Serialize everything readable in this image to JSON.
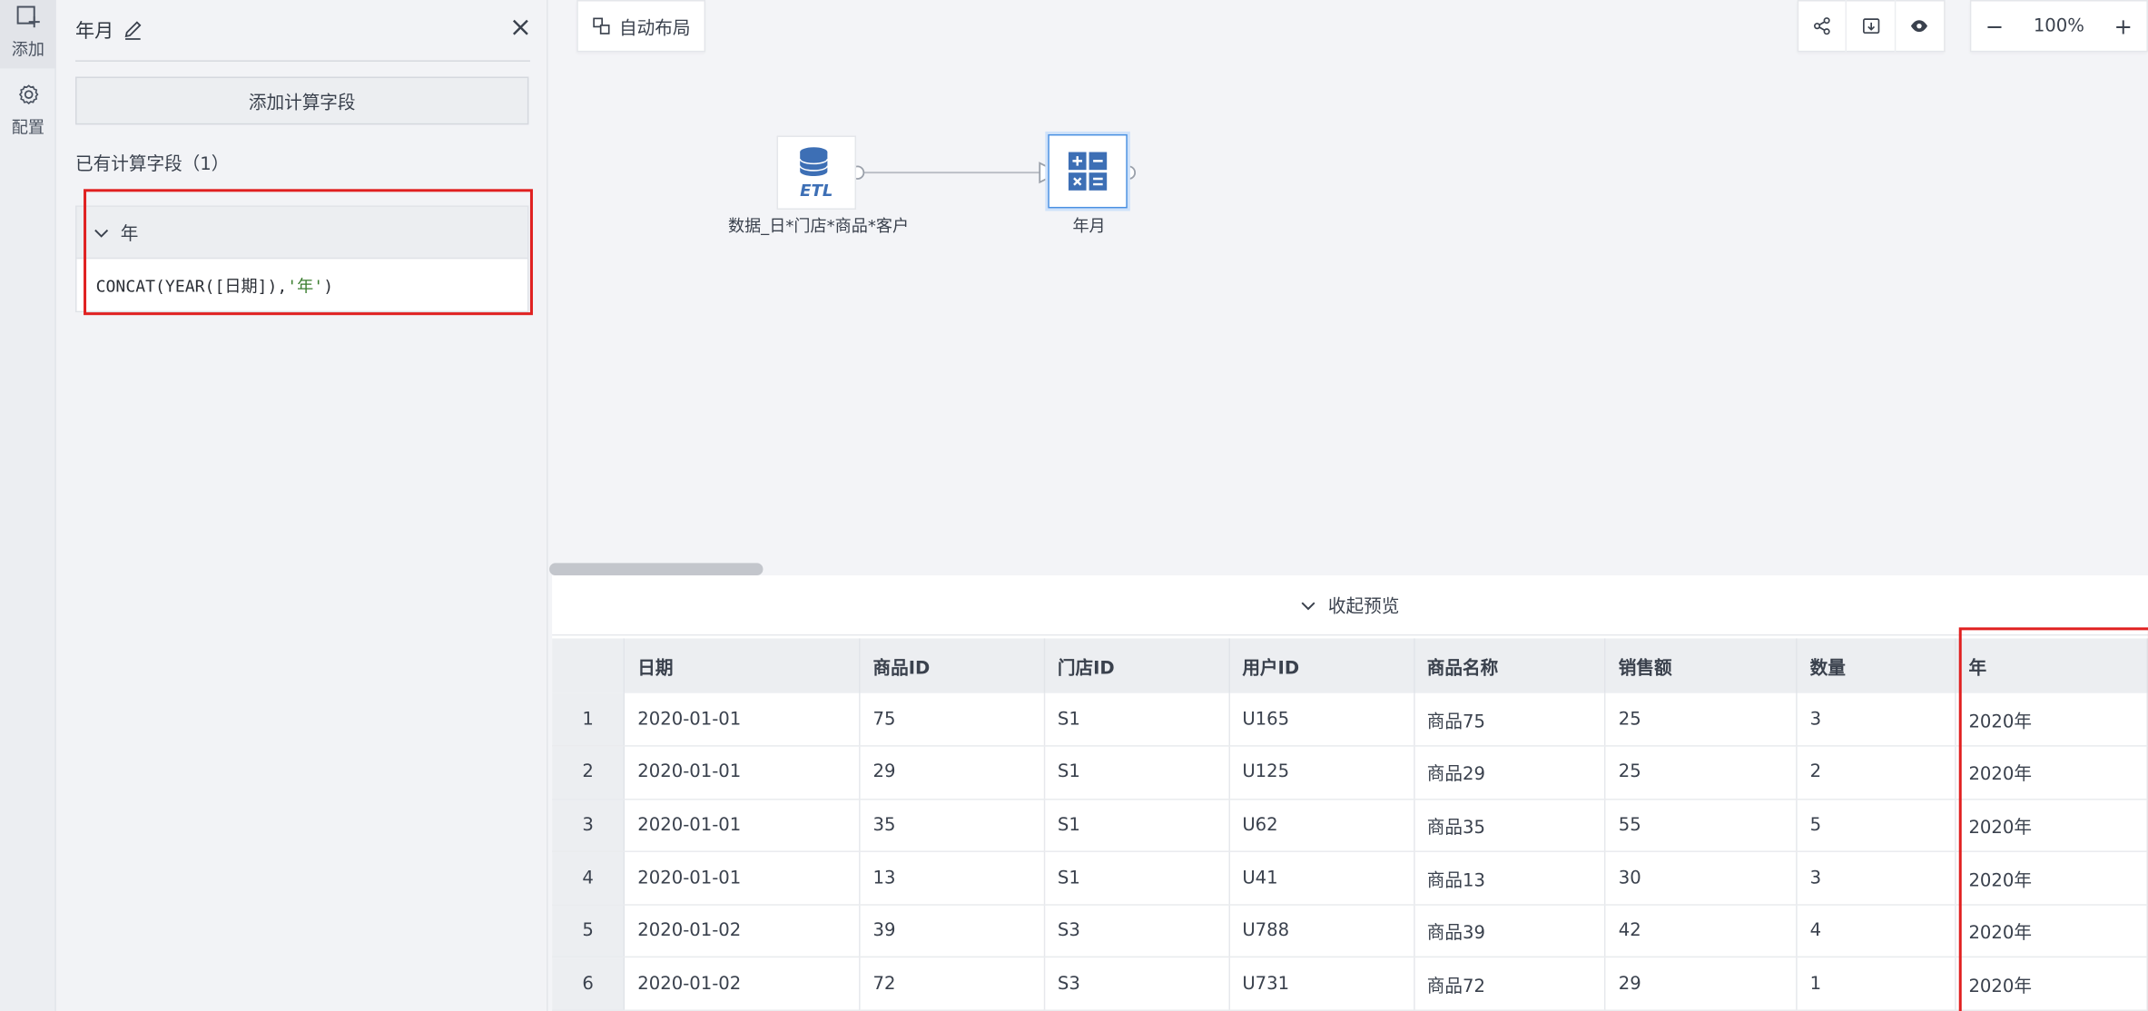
{
  "rail": {
    "add_label": "添加",
    "config_label": "配置"
  },
  "panel": {
    "title": "年月",
    "add_calc_label": "添加计算字段",
    "existing_label": "已有计算字段（1）",
    "field": {
      "name": "年",
      "formula_prefix": "CONCAT(YEAR([日期]),",
      "formula_string": "'年'",
      "formula_suffix": ")"
    }
  },
  "toolbar": {
    "auto_layout_label": "自动布局",
    "zoom_value": "100%",
    "zoom_out": "−",
    "zoom_in": "+",
    "icons": [
      "share-icon",
      "export-icon",
      "eye-icon"
    ]
  },
  "flow": {
    "source_node": {
      "icon_text": "ETL",
      "label": "数据_日*门店*商品*客户"
    },
    "calc_node": {
      "label": "年月"
    }
  },
  "preview": {
    "collapse_label": "收起预览",
    "columns": [
      "日期",
      "商品ID",
      "门店ID",
      "用户ID",
      "商品名称",
      "销售额",
      "数量",
      "年"
    ],
    "rows": [
      {
        "idx": "1",
        "cells": [
          "2020-01-01",
          "75",
          "S1",
          "U165",
          "商品75",
          "25",
          "3",
          "2020年"
        ]
      },
      {
        "idx": "2",
        "cells": [
          "2020-01-01",
          "29",
          "S1",
          "U125",
          "商品29",
          "25",
          "2",
          "2020年"
        ]
      },
      {
        "idx": "3",
        "cells": [
          "2020-01-01",
          "35",
          "S1",
          "U62",
          "商品35",
          "55",
          "5",
          "2020年"
        ]
      },
      {
        "idx": "4",
        "cells": [
          "2020-01-01",
          "13",
          "S1",
          "U41",
          "商品13",
          "30",
          "3",
          "2020年"
        ]
      },
      {
        "idx": "5",
        "cells": [
          "2020-01-02",
          "39",
          "S3",
          "U788",
          "商品39",
          "42",
          "4",
          "2020年"
        ]
      },
      {
        "idx": "6",
        "cells": [
          "2020-01-02",
          "72",
          "S3",
          "U731",
          "商品72",
          "29",
          "1",
          "2020年"
        ]
      }
    ]
  },
  "colors": {
    "highlight": "#e02020",
    "accent_blue": "#4a90e2",
    "etl_blue": "#3d6fb5"
  }
}
